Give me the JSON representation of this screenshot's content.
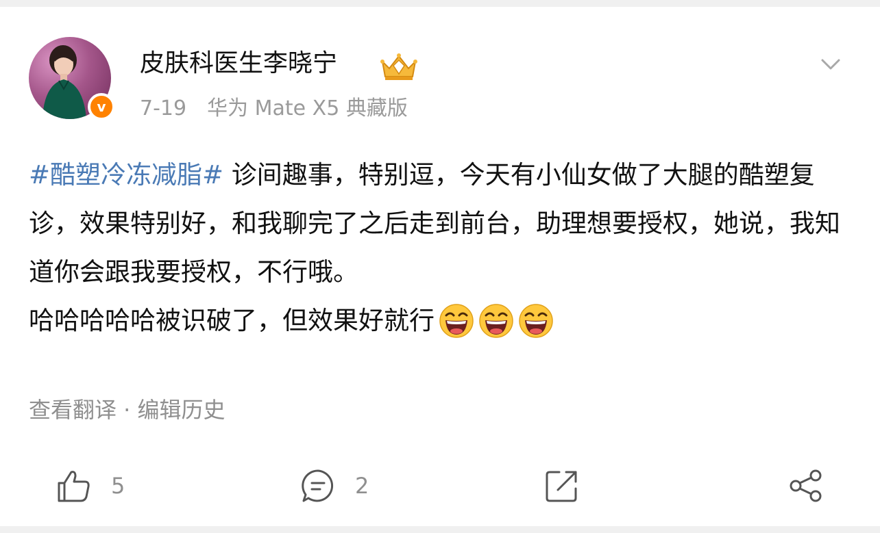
{
  "post": {
    "author": {
      "name": "皮肤科医生李晓宁",
      "verified_mark": "v"
    },
    "date": "7-19",
    "device": "华为 Mate X5 典藏版",
    "hashtag": "#酷塑冷冻减脂#",
    "paragraph1": " 诊间趣事，特别逗，今天有小仙女做了大腿的酷塑复诊，效果特别好，和我聊完了之后走到前台，助理想要授权，她说，我知道你会跟我要授权，不行哦。",
    "paragraph2": "哈哈哈哈哈被识破了，但效果好就行",
    "emoji": [
      "laugh-emoji",
      "laugh-emoji",
      "laugh-emoji"
    ],
    "links": "查看翻译 · 编辑历史"
  },
  "actions": {
    "like_count": "5",
    "comment_count": "2"
  },
  "colors": {
    "hashtag": "#4a7ab5",
    "verified_badge": "#ff8200",
    "muted_text": "#9a9a9a"
  },
  "icons": {
    "like": "thumbs-up-icon",
    "comment": "comment-icon",
    "repost": "repost-icon",
    "share": "share-icon",
    "more": "chevron-down-icon",
    "member": "crown-icon"
  }
}
